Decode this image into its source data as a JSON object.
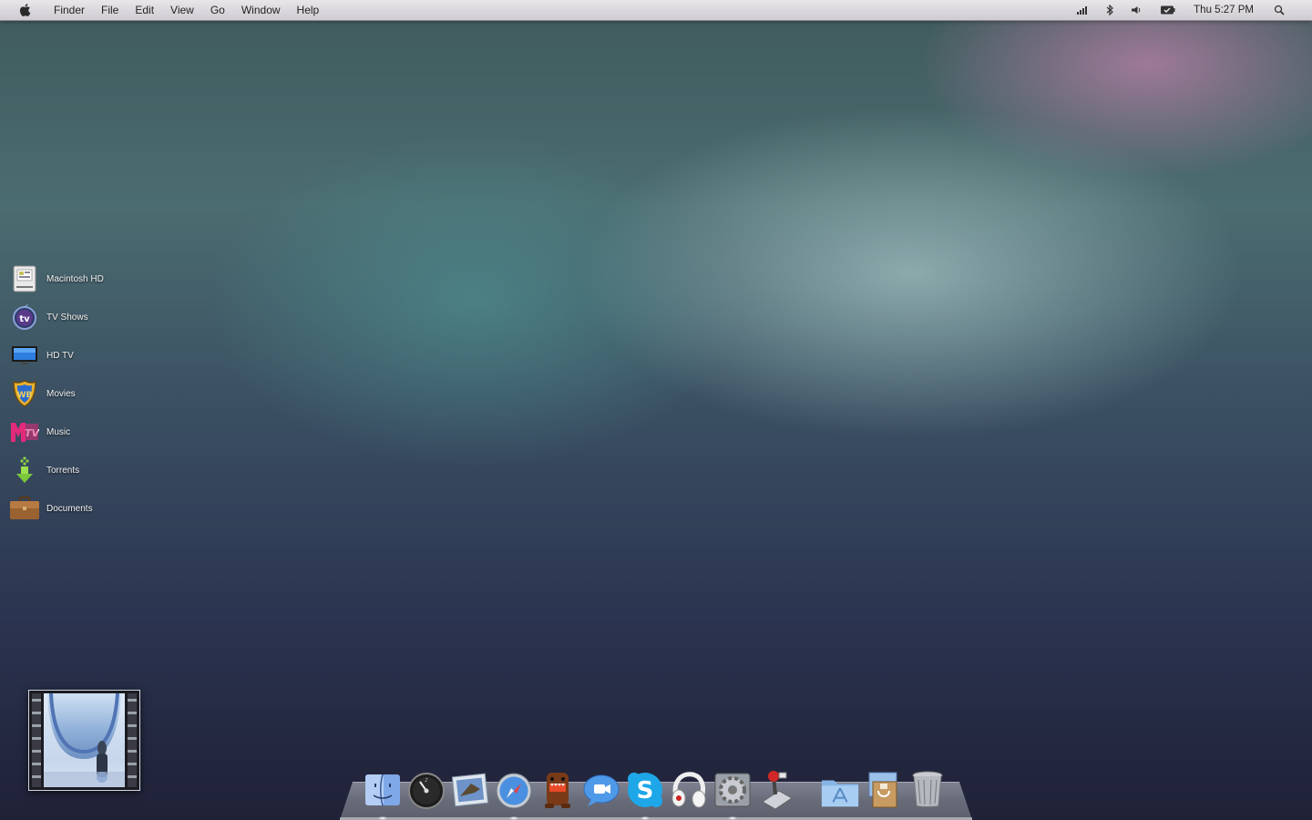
{
  "menubar": {
    "app_name": "Finder",
    "menus": [
      "File",
      "Edit",
      "View",
      "Go",
      "Window",
      "Help"
    ],
    "clock": "Thu 5:27 PM",
    "status_icons": [
      "signal-icon",
      "bluetooth-icon",
      "volume-icon",
      "battery-icon",
      "spotlight-icon"
    ]
  },
  "shortcuts": [
    {
      "label": "Macintosh HD",
      "icon": "hard-drive-icon"
    },
    {
      "label": "TV Shows",
      "icon": "apple-tv-icon"
    },
    {
      "label": "HD TV",
      "icon": "monitor-icon"
    },
    {
      "label": "Movies",
      "icon": "wb-shield-icon"
    },
    {
      "label": "Music",
      "icon": "mtv-icon"
    },
    {
      "label": "Torrents",
      "icon": "download-arrow-icon"
    },
    {
      "label": "Documents",
      "icon": "briefcase-icon"
    }
  ],
  "dock": {
    "apps": [
      "finder-icon",
      "dashboard-icon",
      "mail-icon",
      "safari-icon",
      "domo-icon",
      "ichat-icon",
      "skype-icon",
      "headphones-icon",
      "system-preferences-icon",
      "joystick-icon"
    ],
    "others": [
      "applications-folder-icon",
      "downloads-stack-icon",
      "trash-icon"
    ]
  },
  "colors": {
    "menubar": "#dcd8de",
    "label_text": "#f2f2f2",
    "wallpaper_pink": "#be82aa",
    "wallpaper_teal": "#4b6c70"
  }
}
